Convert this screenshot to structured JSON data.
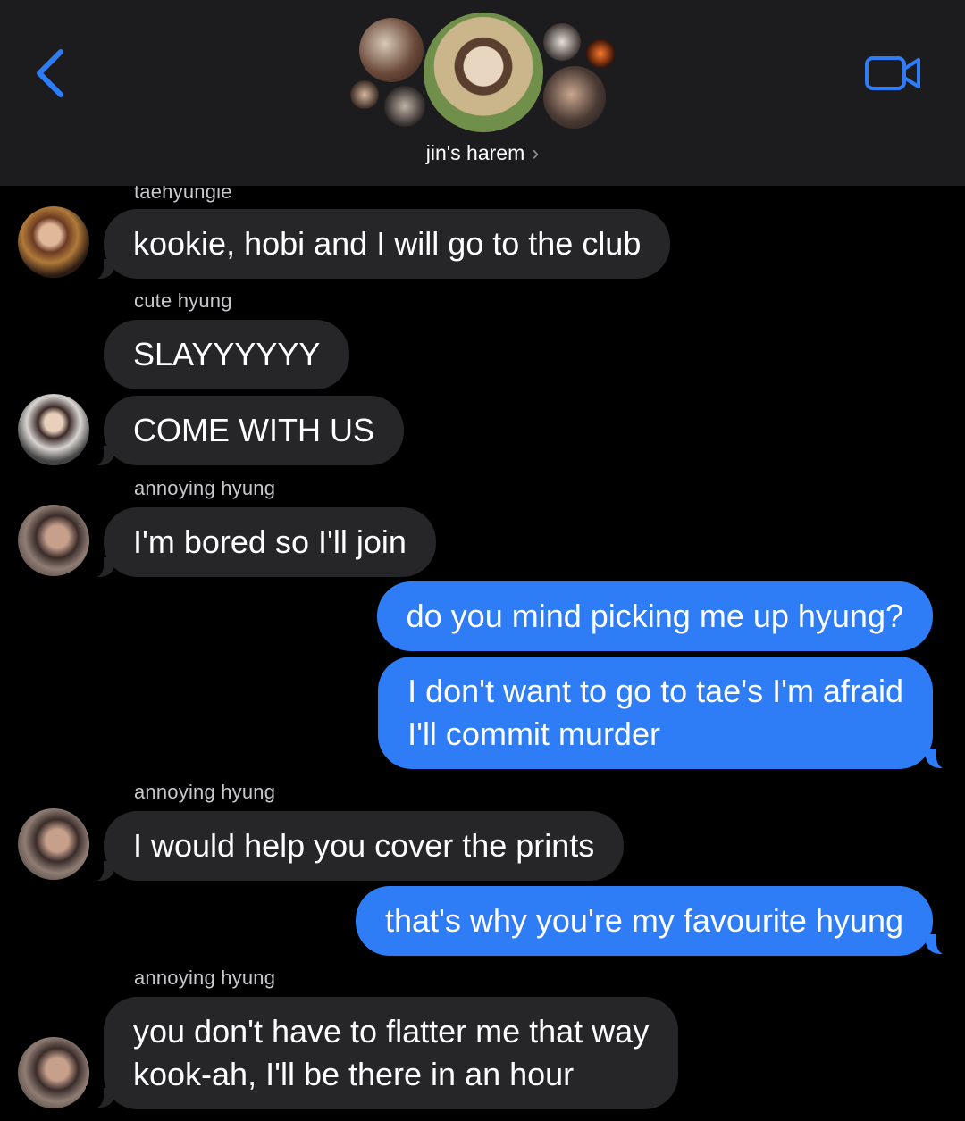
{
  "header": {
    "group_name": "jin's harem",
    "chevron": "›",
    "icons": {
      "back": "chevron-left-icon",
      "video": "video-camera-icon"
    },
    "accent_color": "#2f7df6"
  },
  "messages": [
    {
      "sender": "taehyungie",
      "text": "kookie, hobi and I will go to the club",
      "direction": "incoming"
    },
    {
      "sender": "cute hyung",
      "text": "SLAYYYYYY",
      "direction": "incoming"
    },
    {
      "sender": "",
      "text": "COME WITH US",
      "direction": "incoming"
    },
    {
      "sender": "annoying hyung",
      "text": "I'm bored so I'll join",
      "direction": "incoming"
    },
    {
      "sender": "",
      "text": "do you mind picking me up hyung?",
      "direction": "outgoing"
    },
    {
      "sender": "",
      "lines": [
        "I don't want to go to tae's I'm afraid",
        "I'll commit murder"
      ],
      "direction": "outgoing"
    },
    {
      "sender": "annoying hyung",
      "text": "I would help you cover the prints",
      "direction": "incoming"
    },
    {
      "sender": "",
      "text": "that's why you're my favourite hyung",
      "direction": "outgoing"
    },
    {
      "sender": "annoying hyung",
      "lines": [
        "you don't have to flatter me that way",
        "kook-ah, I'll be there in an hour"
      ],
      "direction": "incoming"
    }
  ],
  "colors": {
    "incoming_bubble": "#262628",
    "outgoing_bubble": "#2f7df6",
    "background": "#000000",
    "header_bg": "#1c1c1e"
  }
}
